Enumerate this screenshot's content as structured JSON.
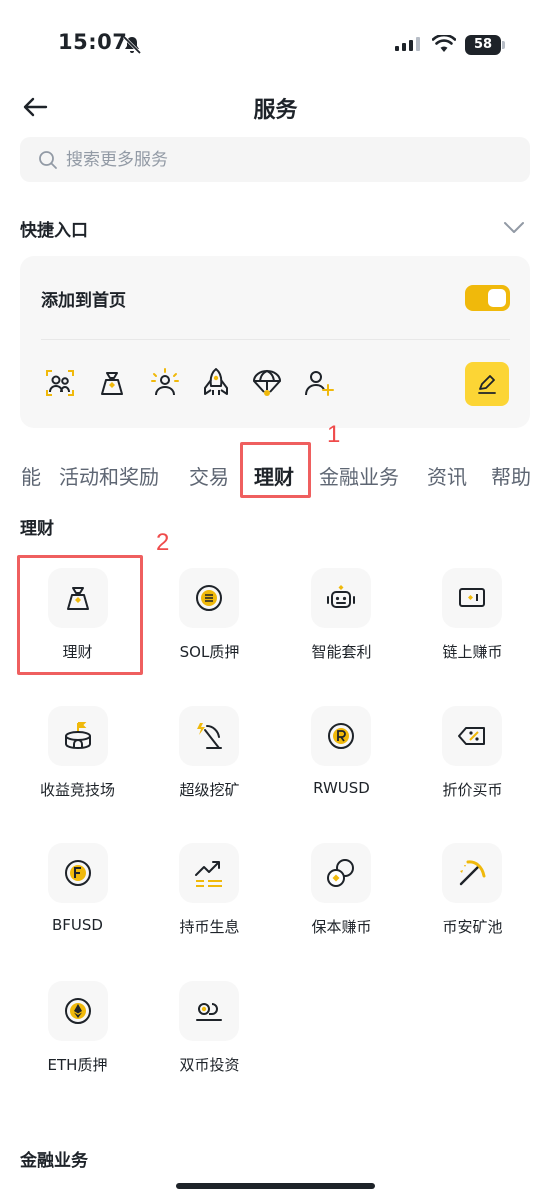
{
  "status": {
    "time": "15:07",
    "battery": "58"
  },
  "header": {
    "title": "服务"
  },
  "search": {
    "placeholder": "搜索更多服务"
  },
  "quick": {
    "title": "快捷入口",
    "add_home_label": "添加到首页",
    "toggle_on": true
  },
  "tabs": [
    "能",
    "活动和奖励",
    "交易",
    "理财",
    "金融业务",
    "资讯",
    "帮助"
  ],
  "annotations": {
    "tab_marker": "1",
    "item_marker": "2"
  },
  "sections": [
    {
      "title": "理财",
      "items": [
        "理财",
        "SOL质押",
        "智能套利",
        "链上赚币",
        "收益竞技场",
        "超级挖矿",
        "RWUSD",
        "折价买币",
        "BFUSD",
        "持币生息",
        "保本赚币",
        "币安矿池",
        "ETH质押",
        "双币投资"
      ]
    },
    {
      "title": "金融业务"
    }
  ],
  "colors": {
    "accent": "#F0B90B",
    "highlight": "#FCD535",
    "annotation": "#EF5F5F",
    "text": "#1E2329"
  }
}
